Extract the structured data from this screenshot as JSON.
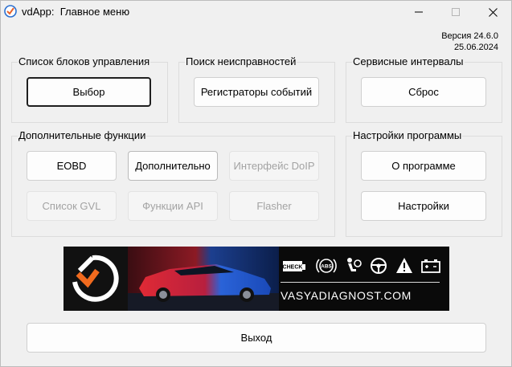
{
  "window": {
    "title": "vdApp:  Главное меню",
    "icons": {
      "app": "vdapp-logo-icon",
      "minimize": "minimize-icon",
      "maximize": "maximize-icon",
      "close": "close-icon"
    }
  },
  "version": {
    "version_text": "Версия 24.6.0",
    "date_text": "25.06.2024"
  },
  "groups": {
    "control_units": {
      "label": "Список блоков управления",
      "select_button": "Выбор"
    },
    "fault_search": {
      "label": "Поиск неисправностей",
      "event_recorders_button": "Регистраторы событий"
    },
    "service_intervals": {
      "label": "Сервисные интервалы",
      "reset_button": "Сброс"
    },
    "additional_functions": {
      "label": "Дополнительные функции",
      "buttons": [
        {
          "label": "EOBD",
          "enabled": true
        },
        {
          "label": "Дополнительно",
          "enabled": true
        },
        {
          "label": "Интерфейс DoIP",
          "enabled": false
        },
        {
          "label": "Список GVL",
          "enabled": false
        },
        {
          "label": "Функции API",
          "enabled": false
        },
        {
          "label": "Flasher",
          "enabled": false
        }
      ]
    },
    "program_settings": {
      "label": "Настройки программы",
      "about_button": "О программе",
      "settings_button": "Настройки"
    }
  },
  "banner": {
    "site": "VASYADIAGNOST.COM",
    "badge_check": "CHECK",
    "badge_abs": "ABS",
    "icons": [
      "check-engine-icon",
      "abs-icon",
      "airbag-icon",
      "steering-wheel-icon",
      "warning-triangle-icon",
      "battery-icon"
    ]
  },
  "exit_button": "Выход",
  "colors": {
    "window_bg": "#f0f0f0",
    "banner_bg": "#0a0a0a",
    "logo_accent": "#f06a1e",
    "car_red": "#d81f2a",
    "car_blue": "#1f5fd6"
  }
}
